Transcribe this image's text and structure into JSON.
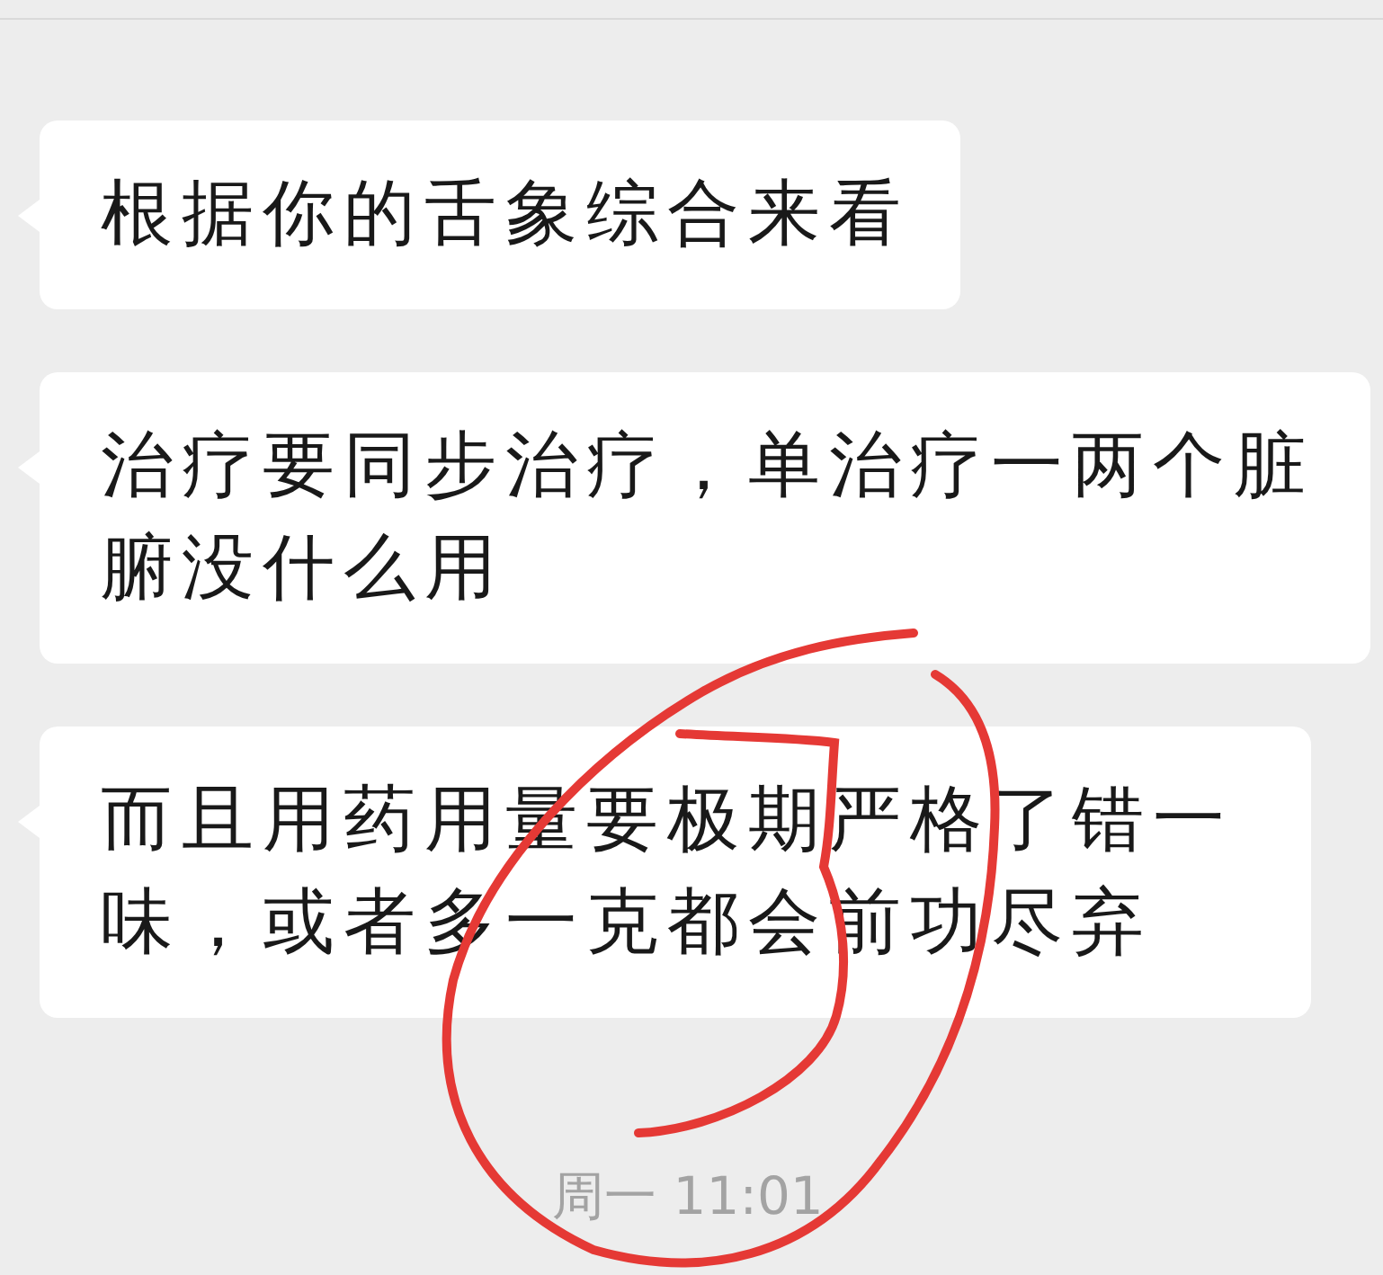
{
  "messages": [
    {
      "text": "根据你的舌象综合来看"
    },
    {
      "text": "治疗要同步治疗，单治疗一两个脏腑没什么用"
    },
    {
      "text": "而且用药用量要极期严格了错一味，或者多一克都会前功尽弃"
    }
  ],
  "timestamp": "周一 11:01"
}
